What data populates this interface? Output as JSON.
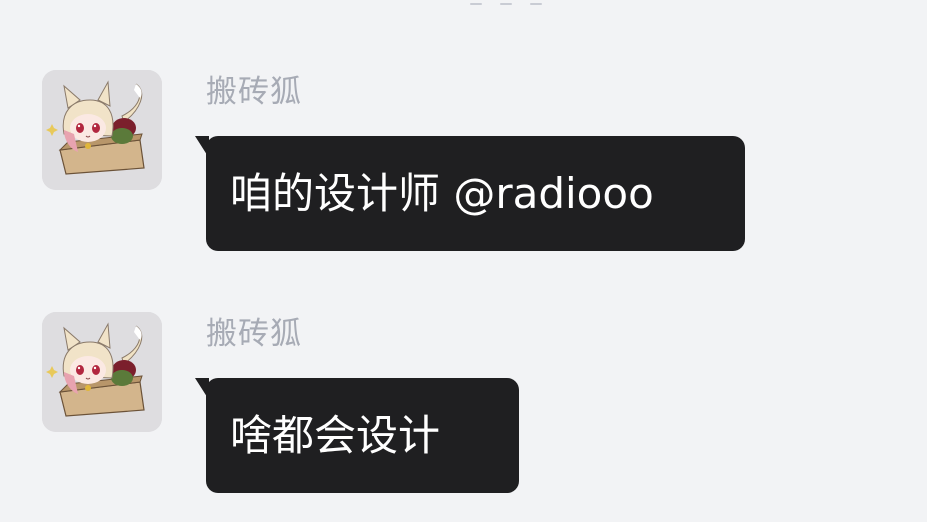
{
  "messages": [
    {
      "sender": "搬砖狐",
      "avatar_icon": "fox-girl-in-box-icon",
      "text": "咱的设计师 @radiooo"
    },
    {
      "sender": "搬砖狐",
      "avatar_icon": "fox-girl-in-box-icon",
      "text": "啥都会设计"
    }
  ],
  "colors": {
    "background": "#f2f3f5",
    "bubble": "#1f1f21",
    "bubble_text": "#ffffff",
    "sender_name": "#a7abb5"
  }
}
